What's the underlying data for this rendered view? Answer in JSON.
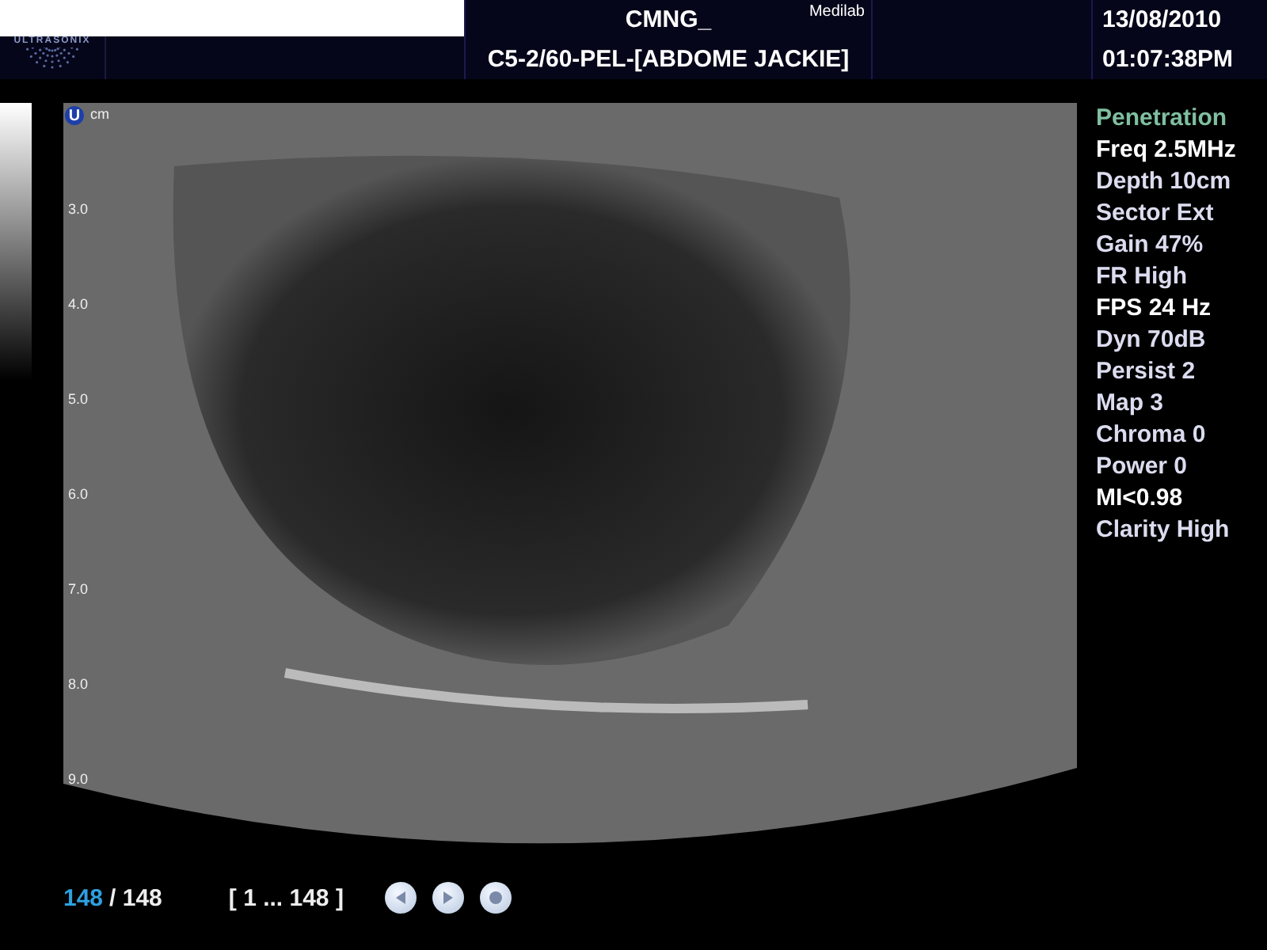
{
  "header": {
    "logo": "ULTRASONIX",
    "patient_id": "CMNG_",
    "site": "Medilab",
    "preset": "C5-2/60-PEL-[ABDOME JACKIE]",
    "date": "13/08/2010",
    "time": "01:07:38PM"
  },
  "image": {
    "probe_badge": "U",
    "depth_unit": "cm",
    "depth_marks": [
      "3.0",
      "4.0",
      "5.0",
      "6.0",
      "7.0",
      "8.0",
      "9.0"
    ]
  },
  "parameters": [
    {
      "text": "Penetration",
      "kind": "preset"
    },
    {
      "text": "Freq 2.5MHz",
      "kind": "bright"
    },
    {
      "text": "Depth 10cm",
      "kind": "param"
    },
    {
      "text": "Sector Ext",
      "kind": "param"
    },
    {
      "text": "Gain 47%",
      "kind": "param"
    },
    {
      "text": "FR High",
      "kind": "param"
    },
    {
      "text": "FPS 24 Hz",
      "kind": "bright"
    },
    {
      "text": "Dyn 70dB",
      "kind": "param"
    },
    {
      "text": "Persist 2",
      "kind": "param"
    },
    {
      "text": "Map 3",
      "kind": "param"
    },
    {
      "text": "Chroma 0",
      "kind": "param"
    },
    {
      "text": "Power 0",
      "kind": "param"
    },
    {
      "text": "MI<0.98",
      "kind": "bright"
    },
    {
      "text": "Clarity High",
      "kind": "param"
    }
  ],
  "cine": {
    "current": "148",
    "total": "/ 148",
    "range": "[ 1 ... 148 ]",
    "buttons": [
      {
        "kind": "previous"
      },
      {
        "kind": "play"
      },
      {
        "kind": "stop"
      }
    ]
  }
}
